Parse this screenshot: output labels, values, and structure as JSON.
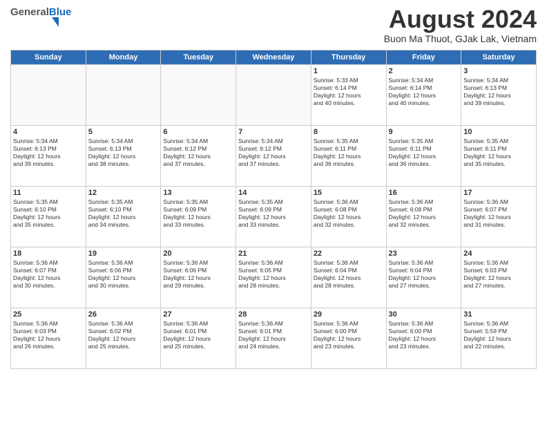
{
  "header": {
    "logo_general": "General",
    "logo_blue": "Blue",
    "month_year": "August 2024",
    "location": "Buon Ma Thuot, GJak Lak, Vietnam"
  },
  "days_of_week": [
    "Sunday",
    "Monday",
    "Tuesday",
    "Wednesday",
    "Thursday",
    "Friday",
    "Saturday"
  ],
  "weeks": [
    [
      {
        "day": "",
        "info": ""
      },
      {
        "day": "",
        "info": ""
      },
      {
        "day": "",
        "info": ""
      },
      {
        "day": "",
        "info": ""
      },
      {
        "day": "1",
        "info": "Sunrise: 5:33 AM\nSunset: 6:14 PM\nDaylight: 12 hours\nand 40 minutes."
      },
      {
        "day": "2",
        "info": "Sunrise: 5:34 AM\nSunset: 6:14 PM\nDaylight: 12 hours\nand 40 minutes."
      },
      {
        "day": "3",
        "info": "Sunrise: 5:34 AM\nSunset: 6:13 PM\nDaylight: 12 hours\nand 39 minutes."
      }
    ],
    [
      {
        "day": "4",
        "info": "Sunrise: 5:34 AM\nSunset: 6:13 PM\nDaylight: 12 hours\nand 39 minutes."
      },
      {
        "day": "5",
        "info": "Sunrise: 5:34 AM\nSunset: 6:13 PM\nDaylight: 12 hours\nand 38 minutes."
      },
      {
        "day": "6",
        "info": "Sunrise: 5:34 AM\nSunset: 6:12 PM\nDaylight: 12 hours\nand 37 minutes."
      },
      {
        "day": "7",
        "info": "Sunrise: 5:34 AM\nSunset: 6:12 PM\nDaylight: 12 hours\nand 37 minutes."
      },
      {
        "day": "8",
        "info": "Sunrise: 5:35 AM\nSunset: 6:11 PM\nDaylight: 12 hours\nand 36 minutes."
      },
      {
        "day": "9",
        "info": "Sunrise: 5:35 AM\nSunset: 6:11 PM\nDaylight: 12 hours\nand 36 minutes."
      },
      {
        "day": "10",
        "info": "Sunrise: 5:35 AM\nSunset: 6:11 PM\nDaylight: 12 hours\nand 35 minutes."
      }
    ],
    [
      {
        "day": "11",
        "info": "Sunrise: 5:35 AM\nSunset: 6:10 PM\nDaylight: 12 hours\nand 35 minutes."
      },
      {
        "day": "12",
        "info": "Sunrise: 5:35 AM\nSunset: 6:10 PM\nDaylight: 12 hours\nand 34 minutes."
      },
      {
        "day": "13",
        "info": "Sunrise: 5:35 AM\nSunset: 6:09 PM\nDaylight: 12 hours\nand 33 minutes."
      },
      {
        "day": "14",
        "info": "Sunrise: 5:35 AM\nSunset: 6:09 PM\nDaylight: 12 hours\nand 33 minutes."
      },
      {
        "day": "15",
        "info": "Sunrise: 5:36 AM\nSunset: 6:08 PM\nDaylight: 12 hours\nand 32 minutes."
      },
      {
        "day": "16",
        "info": "Sunrise: 5:36 AM\nSunset: 6:08 PM\nDaylight: 12 hours\nand 32 minutes."
      },
      {
        "day": "17",
        "info": "Sunrise: 5:36 AM\nSunset: 6:07 PM\nDaylight: 12 hours\nand 31 minutes."
      }
    ],
    [
      {
        "day": "18",
        "info": "Sunrise: 5:36 AM\nSunset: 6:07 PM\nDaylight: 12 hours\nand 30 minutes."
      },
      {
        "day": "19",
        "info": "Sunrise: 5:36 AM\nSunset: 6:06 PM\nDaylight: 12 hours\nand 30 minutes."
      },
      {
        "day": "20",
        "info": "Sunrise: 5:36 AM\nSunset: 6:06 PM\nDaylight: 12 hours\nand 29 minutes."
      },
      {
        "day": "21",
        "info": "Sunrise: 5:36 AM\nSunset: 6:05 PM\nDaylight: 12 hours\nand 28 minutes."
      },
      {
        "day": "22",
        "info": "Sunrise: 5:36 AM\nSunset: 6:04 PM\nDaylight: 12 hours\nand 28 minutes."
      },
      {
        "day": "23",
        "info": "Sunrise: 5:36 AM\nSunset: 6:04 PM\nDaylight: 12 hours\nand 27 minutes."
      },
      {
        "day": "24",
        "info": "Sunrise: 5:36 AM\nSunset: 6:03 PM\nDaylight: 12 hours\nand 27 minutes."
      }
    ],
    [
      {
        "day": "25",
        "info": "Sunrise: 5:36 AM\nSunset: 6:03 PM\nDaylight: 12 hours\nand 26 minutes."
      },
      {
        "day": "26",
        "info": "Sunrise: 5:36 AM\nSunset: 6:02 PM\nDaylight: 12 hours\nand 25 minutes."
      },
      {
        "day": "27",
        "info": "Sunrise: 5:36 AM\nSunset: 6:01 PM\nDaylight: 12 hours\nand 25 minutes."
      },
      {
        "day": "28",
        "info": "Sunrise: 5:36 AM\nSunset: 6:01 PM\nDaylight: 12 hours\nand 24 minutes."
      },
      {
        "day": "29",
        "info": "Sunrise: 5:36 AM\nSunset: 6:00 PM\nDaylight: 12 hours\nand 23 minutes."
      },
      {
        "day": "30",
        "info": "Sunrise: 5:36 AM\nSunset: 6:00 PM\nDaylight: 12 hours\nand 23 minutes."
      },
      {
        "day": "31",
        "info": "Sunrise: 5:36 AM\nSunset: 5:59 PM\nDaylight: 12 hours\nand 22 minutes."
      }
    ]
  ]
}
